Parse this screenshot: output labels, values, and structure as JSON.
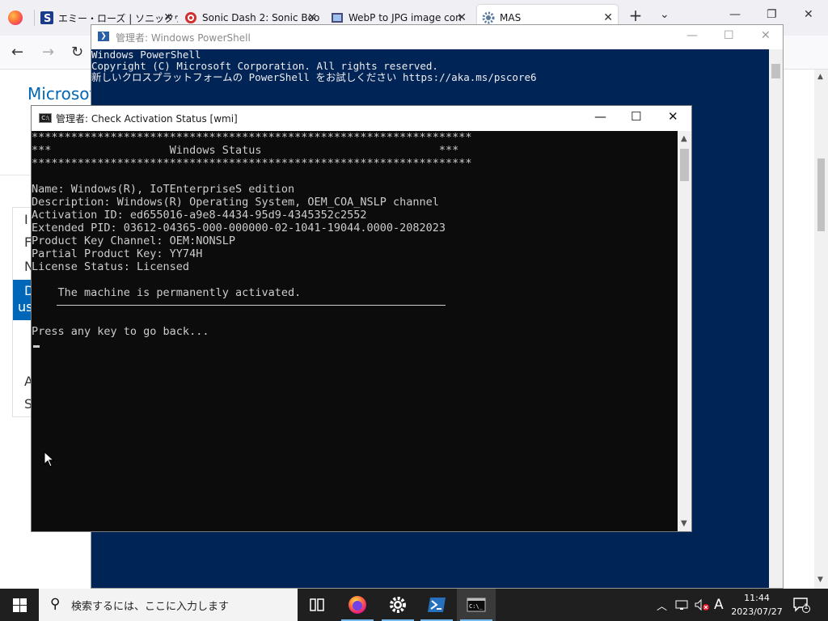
{
  "browser": {
    "tabs": [
      {
        "title": "エミー・ローズ | ソニックウィ",
        "icon": "sonic-wiki-icon"
      },
      {
        "title": "Sonic Dash 2: Sonic Boo",
        "icon": "sonic-dash-icon"
      },
      {
        "title": "WebP to JPG image con",
        "icon": "converter-icon"
      },
      {
        "title": "MAS",
        "icon": "gear-icon"
      }
    ],
    "page": {
      "logo_text": "Microsof",
      "menu_items": [
        "I",
        "F",
        "N",
        "D",
        "us",
        "A",
        "S"
      ]
    }
  },
  "powershell": {
    "title": "管理者: Windows PowerShell",
    "lines": [
      "Windows PowerShell",
      "Copyright (C) Microsoft Corporation. All rights reserved.",
      "",
      "新しいクロスプラットフォームの PowerShell をお試しください https://aka.ms/pscore6"
    ]
  },
  "cmd": {
    "title": "管理者:  Check Activation Status [wmi]",
    "lines": [
      "*******************************************************************",
      "***                  Windows Status                           ***",
      "*******************************************************************",
      "",
      "Name: Windows(R), IoTEnterpriseS edition",
      "Description: Windows(R) Operating System, OEM_COA_NSLP channel",
      "Activation ID: ed655016-a9e8-4434-95d9-4345352c2552",
      "Extended PID: 03612-04365-000-000000-02-1041-19044.0000-2082023",
      "Product Key Channel: OEM:NONSLP",
      "Partial Product Key: YY74H",
      "License Status: Licensed",
      "",
      "    The machine is permanently activated."
    ],
    "prompt": "Press any key to go back..."
  },
  "taskbar": {
    "search_placeholder": "検索するには、ここに入力します",
    "pinned": [
      "task-view-icon",
      "firefox-icon",
      "settings-gear-icon",
      "powershell-icon",
      "cmd-icon"
    ],
    "ime": "A",
    "time": "11:44",
    "date": "2023/07/27",
    "notifications": "1"
  },
  "colors": {
    "powershell_bg": "#012456",
    "cmd_bg": "#0c0c0c",
    "taskbar_bg": "#1f1f1f",
    "accent": "#0067b8"
  }
}
